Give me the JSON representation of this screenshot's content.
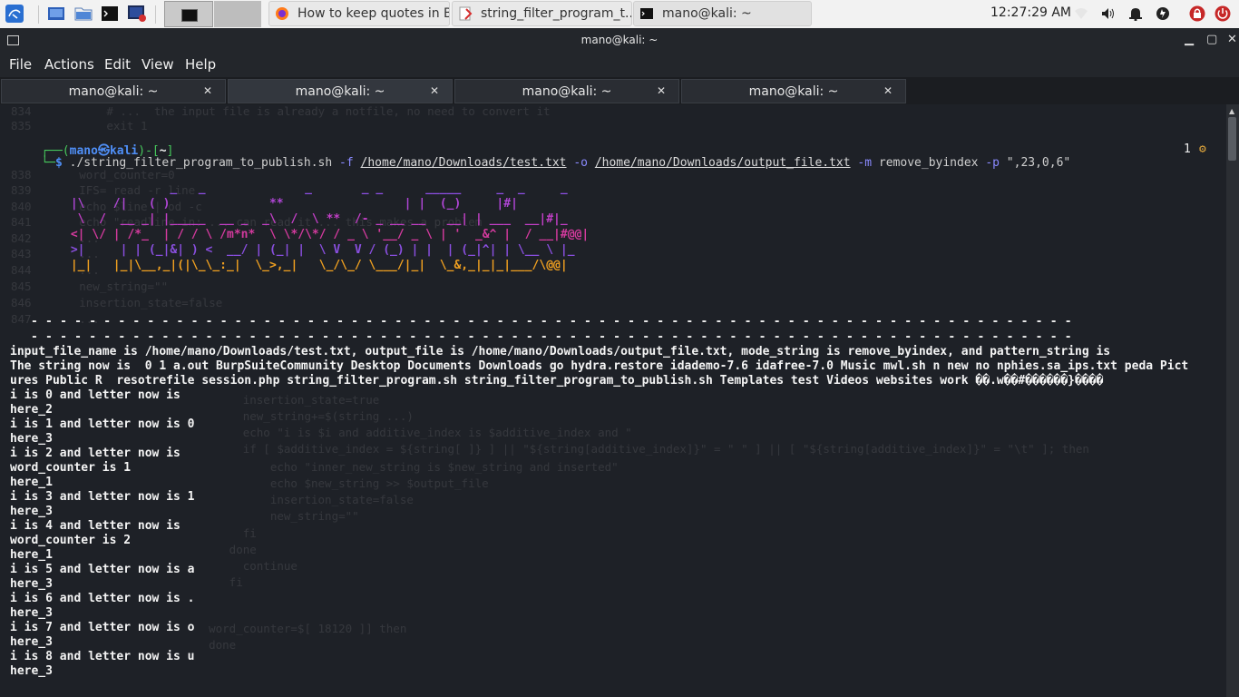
{
  "panel": {
    "launchers": [
      "kali-menu-icon",
      "show-desktop-icon",
      "file-manager-icon",
      "terminal-icon",
      "terminal-root-icon"
    ],
    "workspaces": [
      "1",
      "2"
    ],
    "tasks": [
      {
        "label": "How to keep quotes in B...",
        "icon": "firefox-icon"
      },
      {
        "label": "string_filter_program_t...",
        "icon": "text-editor-icon"
      },
      {
        "label": "mano@kali: ~",
        "icon": "terminal-icon"
      }
    ],
    "clock": "12:27:29 AM",
    "tray": [
      "network-icon",
      "volume-icon",
      "notification-bell-icon",
      "power-icon",
      "lock-icon",
      "logout-icon"
    ]
  },
  "window": {
    "title": "mano@kali: ~",
    "menu": [
      "File",
      "Actions",
      "Edit",
      "View",
      "Help"
    ],
    "tabs": [
      {
        "label": "mano@kali: ~",
        "active": false
      },
      {
        "label": "mano@kali: ~",
        "active": true
      },
      {
        "label": "mano@kali: ~",
        "active": false
      },
      {
        "label": "mano@kali: ~",
        "active": false
      }
    ]
  },
  "prompt": {
    "user": "mano",
    "host": "kali",
    "dir": "~",
    "at_symbol": "㉿",
    "script": "./string_filter_program_to_publish.sh",
    "opt_f": "-f",
    "arg_f": "/home/mano/Downloads/test.txt",
    "opt_o": "-o",
    "arg_o": "/home/mano/Downloads/output_file.txt",
    "opt_m": "-m",
    "arg_m": "remove_byindex",
    "opt_p": "-p",
    "arg_p": "\",23,0,6\"",
    "job_count": "1",
    "status_icon": "gear-icon"
  },
  "banner": {
    "l0": "               _   _              _       _ _      _____     _  _     _   ",
    "l1": " |\\    /|   ( )              **                 | |  (_)     |#|  ",
    "l2": "  \\  /  __ _| |_____  __ _  _\\  /  \\ **  /- _ __ __   __| | ___  __|#|_  ",
    "l3": " <| \\/ | /*_  | / / \\ /m*n*  \\ \\*/\\*/ / _ \\ '__/ _ \\ | '  _&^ |  / __|#@@| ",
    "l4": " >|     | | (_|&| ) <  __/ | (_| |  \\ V  V / (_) | |  | (_|^| | \\__ \\ |_  ",
    "l5": " |_|   |_|\\__,_|(|\\_\\_:_|  \\_>,_|   \\_/\\_/ \\___/|_|  \\_&,_|_|_|___/\\@@| "
  },
  "separator": "- - - - - - - - - - - - - - - - - - - - - - - - - - - - - - - - - - - - - - - - - - - - - - - - - - - - - - - - - - - - - - - - - - - - - - - -",
  "output": [
    "input_file_name is /home/mano/Downloads/test.txt, output_file is /home/mano/Downloads/output_file.txt, mode_string is remove_byindex, and pattern_string is",
    "The string now is  0 1 a.out BurpSuiteCommunity Desktop Documents Downloads go hydra.restore idademo-7.6 idafree-7.0 Music mwl.sh n new no nphies.sa_ips.txt peda Pict",
    "ures Public R  resotrefile session.php string_filter_program.sh string_filter_program_to_publish.sh Templates test Videos websites work ��.w��#������}����",
    "i is 0 and letter now is",
    "here_2",
    "i is 1 and letter now is 0",
    "here_3",
    "i is 2 and letter now is",
    "word_counter is 1",
    "here_1",
    "i is 3 and letter now is 1",
    "here_3",
    "i is 4 and letter now is",
    "word_counter is 2",
    "here_1",
    "i is 5 and letter now is a",
    "here_3",
    "i is 6 and letter now is .",
    "here_3",
    "i is 7 and letter now is o",
    "here_3",
    "i is 8 and letter now is u",
    "here_3"
  ],
  "ghost_lines": [
    "834           # ...  the input file is already a notfile, no need to convert it",
    "835           exit 1",
    "838       word_counter=0",
    "839       IFS= read -r line",
    "840       echo $line | od -c",
    "841       echo \"readline in: ... can read it ... this makes a problem",
    "842       ...",
    "843       ...",
    "844       ...",
    "845       new_string=\"\"",
    "846       insertion_state=false",
    "847       ...",
    "         insertion_state=true",
    "         new_string+=$(string ...)",
    "         echo \"i is $i and additive_index is $additive_index and \"",
    "         if [ $additive_index = ${string[ ]} ] || \"${string[additive_index]}\" = \" \" ] || [ \"${string[additive_index]}\" = \"\\t\" ]; then",
    "             echo \"inner_new_string is $new_string and inserted\"",
    "             echo $new_string >> $output_file",
    "             insertion_state=false",
    "             new_string=\"\"",
    "         fi",
    "       done",
    "         continue",
    "       fi",
    "    word_counter=$[ 18120 ]] then",
    "    done"
  ]
}
